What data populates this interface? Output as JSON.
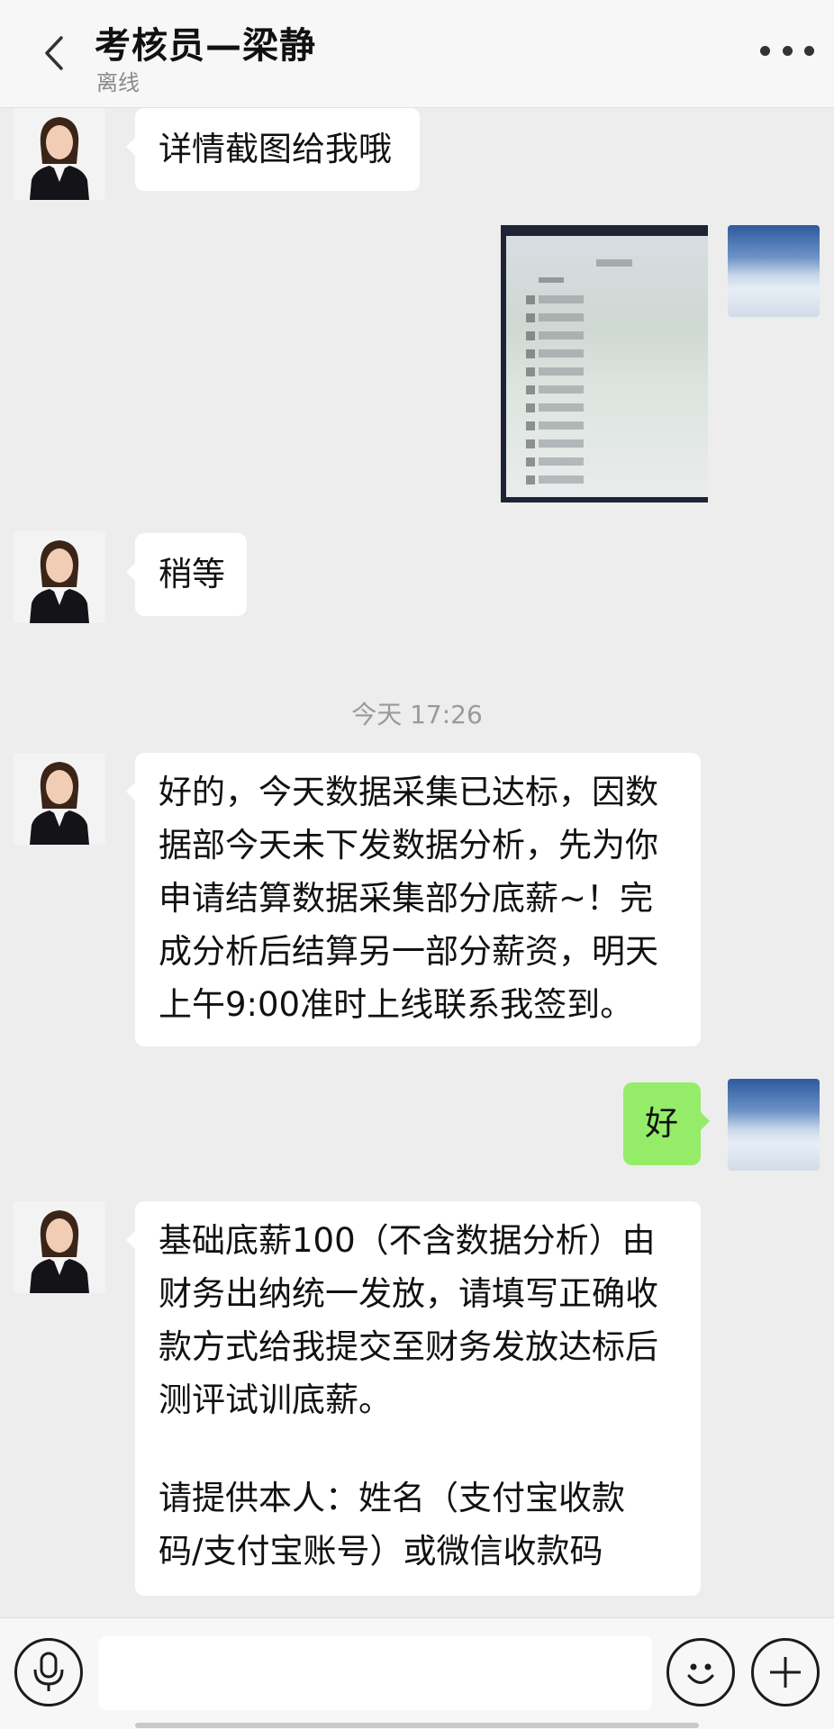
{
  "header": {
    "title": "考核员—梁静",
    "status": "离线"
  },
  "messages": {
    "m1": [
      "详情截图给我哦"
    ],
    "m2": [
      "稍等"
    ],
    "time": "今天 17:26",
    "m3": [
      "好的，今天数据采集已达标，因数",
      "据部今天未下发数据分析，先为你",
      "申请结算数据采集部分底薪~！完",
      "成分析后结算另一部分薪资，明天",
      "上午9:00准时上线联系我签到。"
    ],
    "m4": [
      "好"
    ],
    "m5": [
      "基础底薪100（不含数据分析）由",
      "财务出纳统一发放，请填写正确收",
      "款方式给我提交至财务发放达标后",
      "测评试训底薪。",
      "",
      "请提供本人：姓名（支付宝收款",
      "码/支付宝账号）或微信收款码"
    ]
  },
  "icons": {
    "back": "chevron-left-icon",
    "more": "more-dots-icon",
    "voice": "microphone-icon",
    "emoji": "smiley-icon",
    "plus": "plus-icon"
  },
  "colors": {
    "background": "#ededed",
    "bubble_self": "#95ec69",
    "bubble_other": "#ffffff"
  }
}
